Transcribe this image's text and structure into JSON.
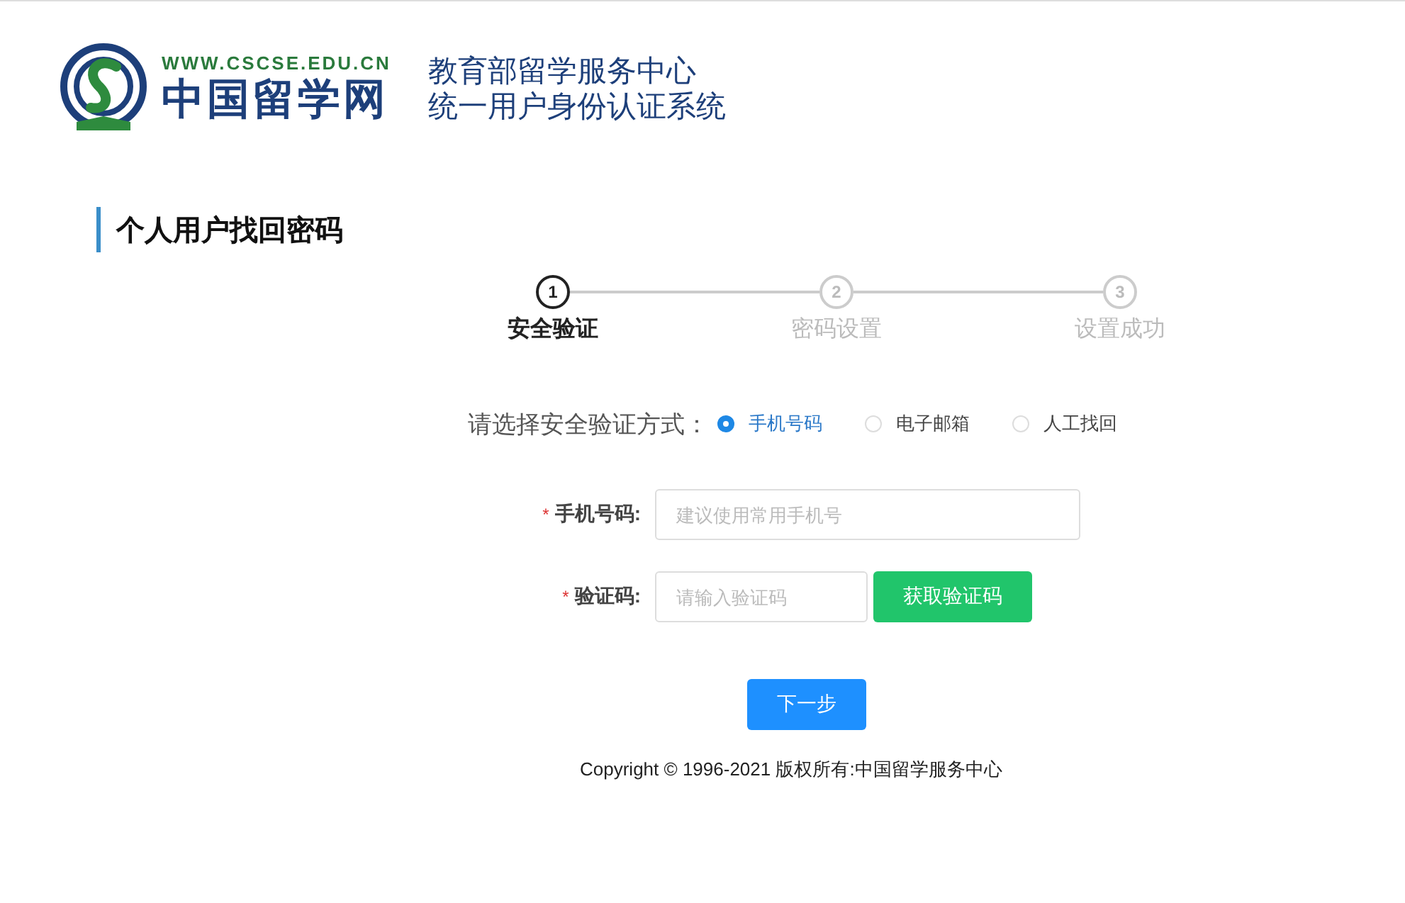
{
  "header": {
    "site_url": "WWW.CSCSE.EDU.CN",
    "site_name": "中国留学网",
    "org_name": "教育部留学服务中心",
    "system_name": "统一用户身份认证系统"
  },
  "page_title": "个人用户找回密码",
  "steps": [
    {
      "number": "1",
      "label": "安全验证",
      "current": true
    },
    {
      "number": "2",
      "label": "密码设置",
      "current": false
    },
    {
      "number": "3",
      "label": "设置成功",
      "current": false
    }
  ],
  "method": {
    "label": "请选择安全验证方式：",
    "options": [
      {
        "label": "手机号码",
        "selected": true
      },
      {
        "label": "电子邮箱",
        "selected": false
      },
      {
        "label": "人工找回",
        "selected": false
      }
    ]
  },
  "fields": [
    {
      "kind": "text",
      "required_mark": "*",
      "label": "手机号码:",
      "placeholder": "建议使用常用手机号"
    },
    {
      "kind": "code",
      "required_mark": "*",
      "label": "验证码:",
      "placeholder": "请输入验证码",
      "button": "获取验证码"
    }
  ],
  "next_button": "下一步",
  "footer": "Copyright © 1996-2021 版权所有:中国留学服务中心"
}
